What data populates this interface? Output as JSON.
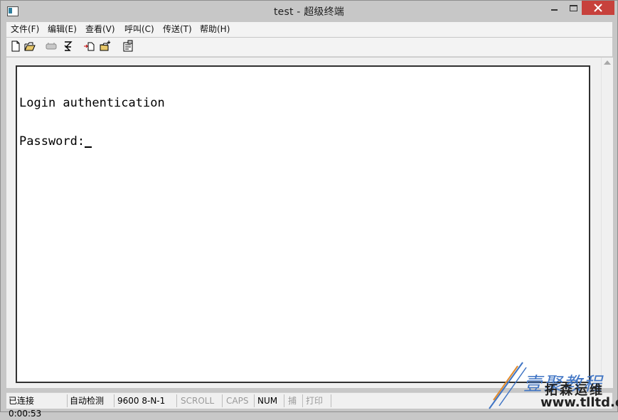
{
  "window": {
    "title": "test - 超级终端"
  },
  "menu": {
    "items": [
      "文件(F)",
      "编辑(E)",
      "查看(V)",
      "呼叫(C)",
      "传送(T)",
      "帮助(H)"
    ]
  },
  "toolbar": {
    "icons": [
      "new-icon",
      "open-icon",
      "disconnect-icon",
      "dial-icon",
      "send-icon",
      "receive-icon",
      "properties-icon"
    ]
  },
  "terminal": {
    "lines": [
      "Login authentication",
      "Password:"
    ]
  },
  "status": {
    "connection": "已连接 0:00:53",
    "detect": "自动检测",
    "port_settings": "9600 8-N-1",
    "scroll": "SCROLL",
    "caps": "CAPS",
    "num": "NUM",
    "capture": "捕",
    "print": "打印"
  },
  "watermark": {
    "line1": "壹聚教程",
    "line2": "拓森运维",
    "url": "www.tlltd.cn"
  },
  "colors": {
    "close_button": "#c7413c",
    "terminal_bg": "#ffffff",
    "watermark_blue": "#3f74c4",
    "watermark_orange": "#e08a2c"
  }
}
